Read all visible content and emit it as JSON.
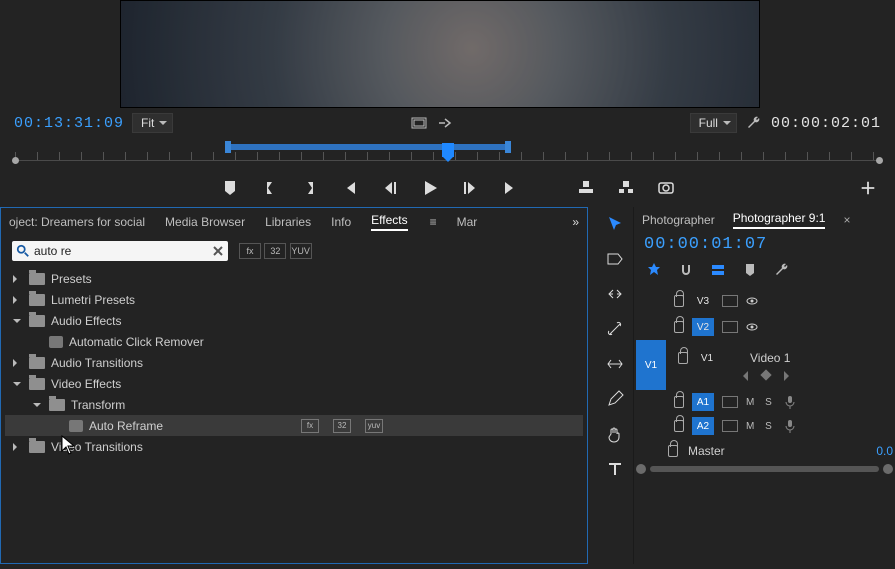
{
  "monitor": {
    "source_timecode": "00:13:31:09",
    "program_timecode": "00:00:02:01",
    "zoom": "Fit",
    "resolution": "Full"
  },
  "panel": {
    "tabs": [
      "oject: Dreamers for social",
      "Media Browser",
      "Libraries",
      "Info",
      "Effects",
      "Mar"
    ],
    "active_tab": "Effects",
    "search_value": "auto re",
    "search_chips": [
      "fx",
      "32",
      "YUV"
    ]
  },
  "tree": [
    {
      "depth": 0,
      "expand": "right",
      "icon": "folder",
      "label": "Presets"
    },
    {
      "depth": 0,
      "expand": "right",
      "icon": "folder",
      "label": "Lumetri Presets"
    },
    {
      "depth": 0,
      "expand": "down",
      "icon": "folder",
      "label": "Audio Effects"
    },
    {
      "depth": 1,
      "expand": "",
      "icon": "fx",
      "label": "Automatic Click Remover"
    },
    {
      "depth": 0,
      "expand": "right",
      "icon": "folder",
      "label": "Audio Transitions"
    },
    {
      "depth": 0,
      "expand": "down",
      "icon": "folder",
      "label": "Video Effects"
    },
    {
      "depth": 1,
      "expand": "down",
      "icon": "folder",
      "label": "Transform"
    },
    {
      "depth": 2,
      "expand": "",
      "icon": "fx",
      "label": "Auto Reframe",
      "selected": true,
      "badges": [
        "fx",
        "32",
        "yuv"
      ]
    },
    {
      "depth": 0,
      "expand": "right",
      "icon": "folder",
      "label": "Video Transitions"
    }
  ],
  "timeline": {
    "tabs": [
      "Photographer",
      "Photographer 9:1"
    ],
    "active_tab": "Photographer 9:1",
    "playhead_timecode": "00:00:01:07",
    "video_tracks": [
      {
        "name": "V3",
        "active": false
      },
      {
        "name": "V2",
        "active": true
      }
    ],
    "v1": {
      "src": "V1",
      "tgt": "V1",
      "clip": "Video 1"
    },
    "audio_tracks": [
      {
        "name": "A1"
      },
      {
        "name": "A2"
      }
    ],
    "master": {
      "label": "Master",
      "value": "0.0"
    }
  }
}
